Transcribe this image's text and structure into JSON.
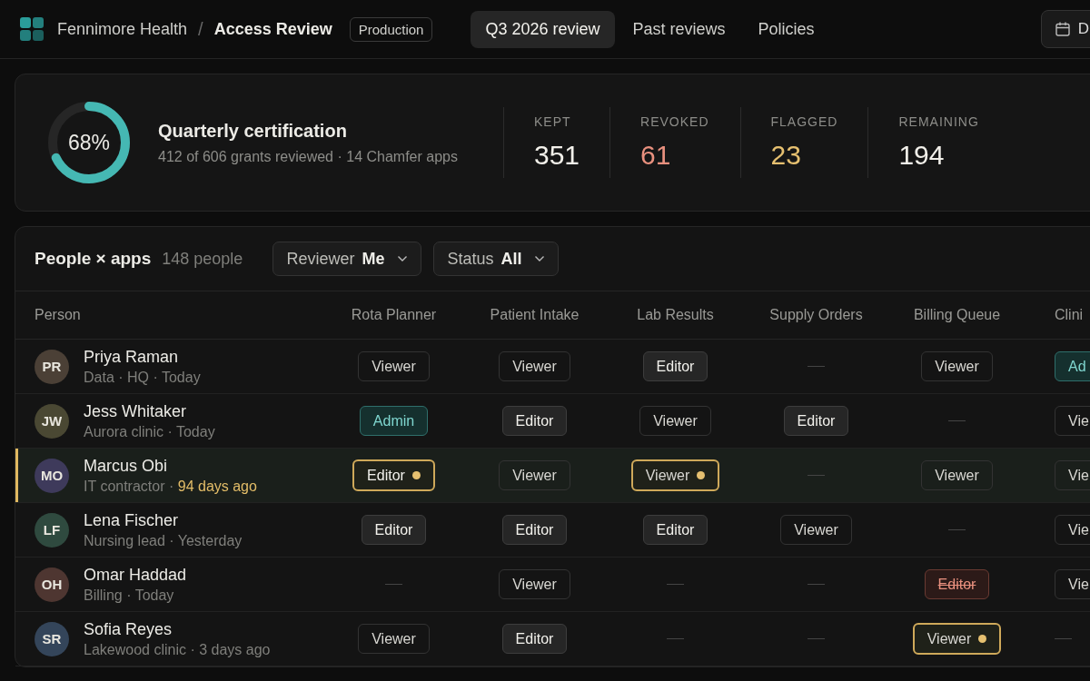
{
  "header": {
    "org": "Fennimore Health",
    "separator": "/",
    "product": "Access Review",
    "environment": "Production",
    "tabs": [
      {
        "label": "Q3 2026 review",
        "selected": true
      },
      {
        "label": "Past reviews",
        "selected": false
      },
      {
        "label": "Policies",
        "selected": false
      }
    ],
    "date_button": "D"
  },
  "summary": {
    "progress": {
      "level": 0.68,
      "label": "68%"
    },
    "title": "Quarterly certification",
    "subtitle": "412 of 606 grants reviewed · 14 Chamfer apps",
    "stats": [
      {
        "label": "KEPT",
        "value": "351",
        "color": "#f2f0ea"
      },
      {
        "label": "REVOKED",
        "value": "61",
        "color": "#e8907e"
      },
      {
        "label": "FLAGGED",
        "value": "23",
        "color": "#e6c070"
      },
      {
        "label": "REMAINING",
        "value": "194",
        "color": "#f2f0ea"
      }
    ]
  },
  "table": {
    "title": "People × apps",
    "count": "148 people",
    "filters": [
      {
        "label": "Reviewer",
        "value": "Me"
      },
      {
        "label": "Status",
        "value": "All"
      }
    ],
    "person_header": "Person",
    "app_columns": [
      "Rota Planner",
      "Patient Intake",
      "Lab Results",
      "Supply Orders",
      "Billing Queue",
      "Clini"
    ],
    "rows": [
      {
        "initials": "PR",
        "name": "Priya Raman",
        "meta": "Data · HQ · ",
        "seen": "Today",
        "stale": false,
        "flagged": false,
        "color": "#4b4036",
        "cells": [
          {
            "kind": "viewer",
            "label": "Viewer",
            "flagged": false
          },
          {
            "kind": "viewer",
            "label": "Viewer",
            "flagged": false
          },
          {
            "kind": "editor",
            "label": "Editor",
            "flagged": false
          },
          {
            "kind": "none"
          },
          {
            "kind": "viewer",
            "label": "Viewer",
            "flagged": false
          },
          {
            "kind": "admin",
            "label": "Ad",
            "flagged": false
          }
        ]
      },
      {
        "initials": "JW",
        "name": "Jess Whitaker",
        "meta": "Aurora clinic · ",
        "seen": "Today",
        "stale": false,
        "flagged": false,
        "color": "#4a4833",
        "cells": [
          {
            "kind": "admin",
            "label": "Admin",
            "flagged": false
          },
          {
            "kind": "editor",
            "label": "Editor",
            "flagged": false
          },
          {
            "kind": "viewer",
            "label": "Viewer",
            "flagged": false
          },
          {
            "kind": "editor",
            "label": "Editor",
            "flagged": false
          },
          {
            "kind": "none"
          },
          {
            "kind": "viewer",
            "label": "Vie",
            "flagged": false
          }
        ]
      },
      {
        "initials": "MO",
        "name": "Marcus Obi",
        "meta": "IT contractor · ",
        "seen": "94 days ago",
        "stale": true,
        "flagged": true,
        "color": "#3e3a5b",
        "cells": [
          {
            "kind": "editor",
            "label": "Editor",
            "flagged": true
          },
          {
            "kind": "viewer",
            "label": "Viewer",
            "flagged": false
          },
          {
            "kind": "viewer",
            "label": "Viewer",
            "flagged": true
          },
          {
            "kind": "none"
          },
          {
            "kind": "viewer",
            "label": "Viewer",
            "flagged": false
          },
          {
            "kind": "viewer",
            "label": "Vie",
            "flagged": false
          }
        ]
      },
      {
        "initials": "LF",
        "name": "Lena Fischer",
        "meta": "Nursing lead · ",
        "seen": "Yesterday",
        "stale": false,
        "flagged": false,
        "color": "#2f4a3f",
        "cells": [
          {
            "kind": "editor",
            "label": "Editor",
            "flagged": false
          },
          {
            "kind": "editor",
            "label": "Editor",
            "flagged": false
          },
          {
            "kind": "editor",
            "label": "Editor",
            "flagged": false
          },
          {
            "kind": "viewer",
            "label": "Viewer",
            "flagged": false
          },
          {
            "kind": "none"
          },
          {
            "kind": "viewer",
            "label": "Vie",
            "flagged": false
          }
        ]
      },
      {
        "initials": "OH",
        "name": "Omar Haddad",
        "meta": "Billing · ",
        "seen": "Today",
        "stale": false,
        "flagged": false,
        "color": "#4e3631",
        "cells": [
          {
            "kind": "none"
          },
          {
            "kind": "viewer",
            "label": "Viewer",
            "flagged": false
          },
          {
            "kind": "none"
          },
          {
            "kind": "none"
          },
          {
            "kind": "revoked",
            "label": "Editor",
            "flagged": false
          },
          {
            "kind": "viewer",
            "label": "Vie",
            "flagged": false
          }
        ]
      },
      {
        "initials": "SR",
        "name": "Sofia Reyes",
        "meta": "Lakewood clinic · ",
        "seen": "3 days ago",
        "stale": false,
        "flagged": false,
        "color": "#34455a",
        "cells": [
          {
            "kind": "viewer",
            "label": "Viewer",
            "flagged": false
          },
          {
            "kind": "editor",
            "label": "Editor",
            "flagged": false
          },
          {
            "kind": "none"
          },
          {
            "kind": "none"
          },
          {
            "kind": "viewer",
            "label": "Viewer",
            "flagged": true
          },
          {
            "kind": "none"
          }
        ]
      }
    ]
  }
}
